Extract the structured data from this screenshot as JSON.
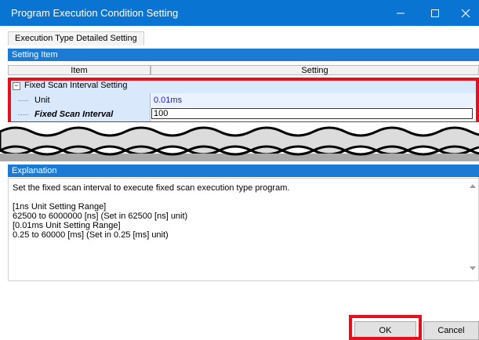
{
  "window": {
    "title": "Program Execution Condition Setting"
  },
  "tab": {
    "label": "Execution Type Detailed Setting"
  },
  "setting_item": {
    "header": "Setting Item"
  },
  "table": {
    "col_item": "Item",
    "col_setting": "Setting",
    "group": {
      "label": "Fixed Scan Interval Setting",
      "expander": "−"
    },
    "rows": [
      {
        "label": "Unit",
        "value": "0.01ms"
      },
      {
        "label": "Fixed Scan Interval",
        "value": "100"
      }
    ]
  },
  "explanation": {
    "header": "Explanation",
    "text": "Set the fixed scan interval to execute fixed scan execution type program.\n\n[1ns Unit Setting Range]\n62500 to 6000000 [ns] (Set in 62500 [ns] unit)\n[0.01ms Unit Setting Range]\n0.25 to 60000 [ms] (Set in 0.25 [ms] unit)"
  },
  "buttons": {
    "ok": "OK",
    "cancel": "Cancel"
  },
  "colors": {
    "titlebar": "#0a74d2",
    "band": "#1a7ad4",
    "highlight": "#e3101d",
    "value_text": "#1f1fb5"
  }
}
